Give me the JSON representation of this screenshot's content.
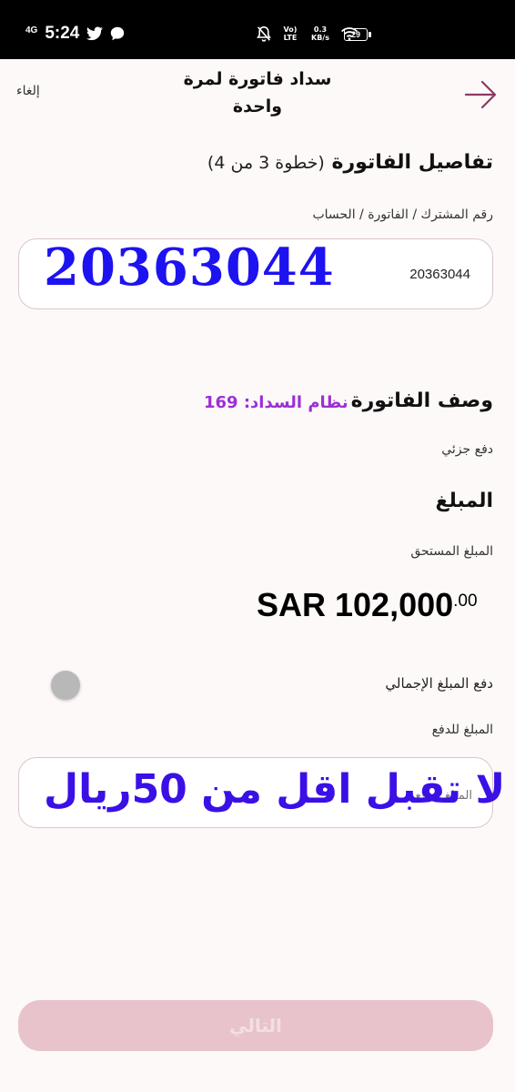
{
  "status_bar": {
    "network": "4G",
    "time": "5:24",
    "volte": "Vo) LTE",
    "speed": "0.3 KB/s",
    "battery": "29"
  },
  "header": {
    "title": "سداد فاتورة لمرة واحدة",
    "cancel_label": "إلغاء"
  },
  "invoice_details": {
    "title": "تفاصيل الفاتورة",
    "step": "(خطوة 3 من 4)",
    "field_label": "رقم المشترك / الفاتورة / الحساب",
    "account_number": "20363044",
    "overlay_number": "20363044"
  },
  "invoice_description": {
    "title": "وصف الفاتورة",
    "payment_system": "نظام السداد: 169",
    "partial_payment": "دفع جزئي"
  },
  "amount_section": {
    "title": "المبلغ",
    "due_label": "المبلغ المستحق",
    "due_main": "SAR 102,000",
    "due_fraction": ".00",
    "total_toggle_label": "دفع المبلغ الإجمالي",
    "pay_label": "المبلغ للدفع",
    "pay_placeholder": "المبلغ للدفع",
    "overlay_text": "لا تقبل اقل من 50ريال"
  },
  "footer": {
    "next_label": "التالي"
  },
  "colors": {
    "accent": "#8b3a62",
    "overlay_blue": "#1d12f0",
    "purple": "#9c2fd6",
    "button_disabled": "#e8c3cb"
  }
}
